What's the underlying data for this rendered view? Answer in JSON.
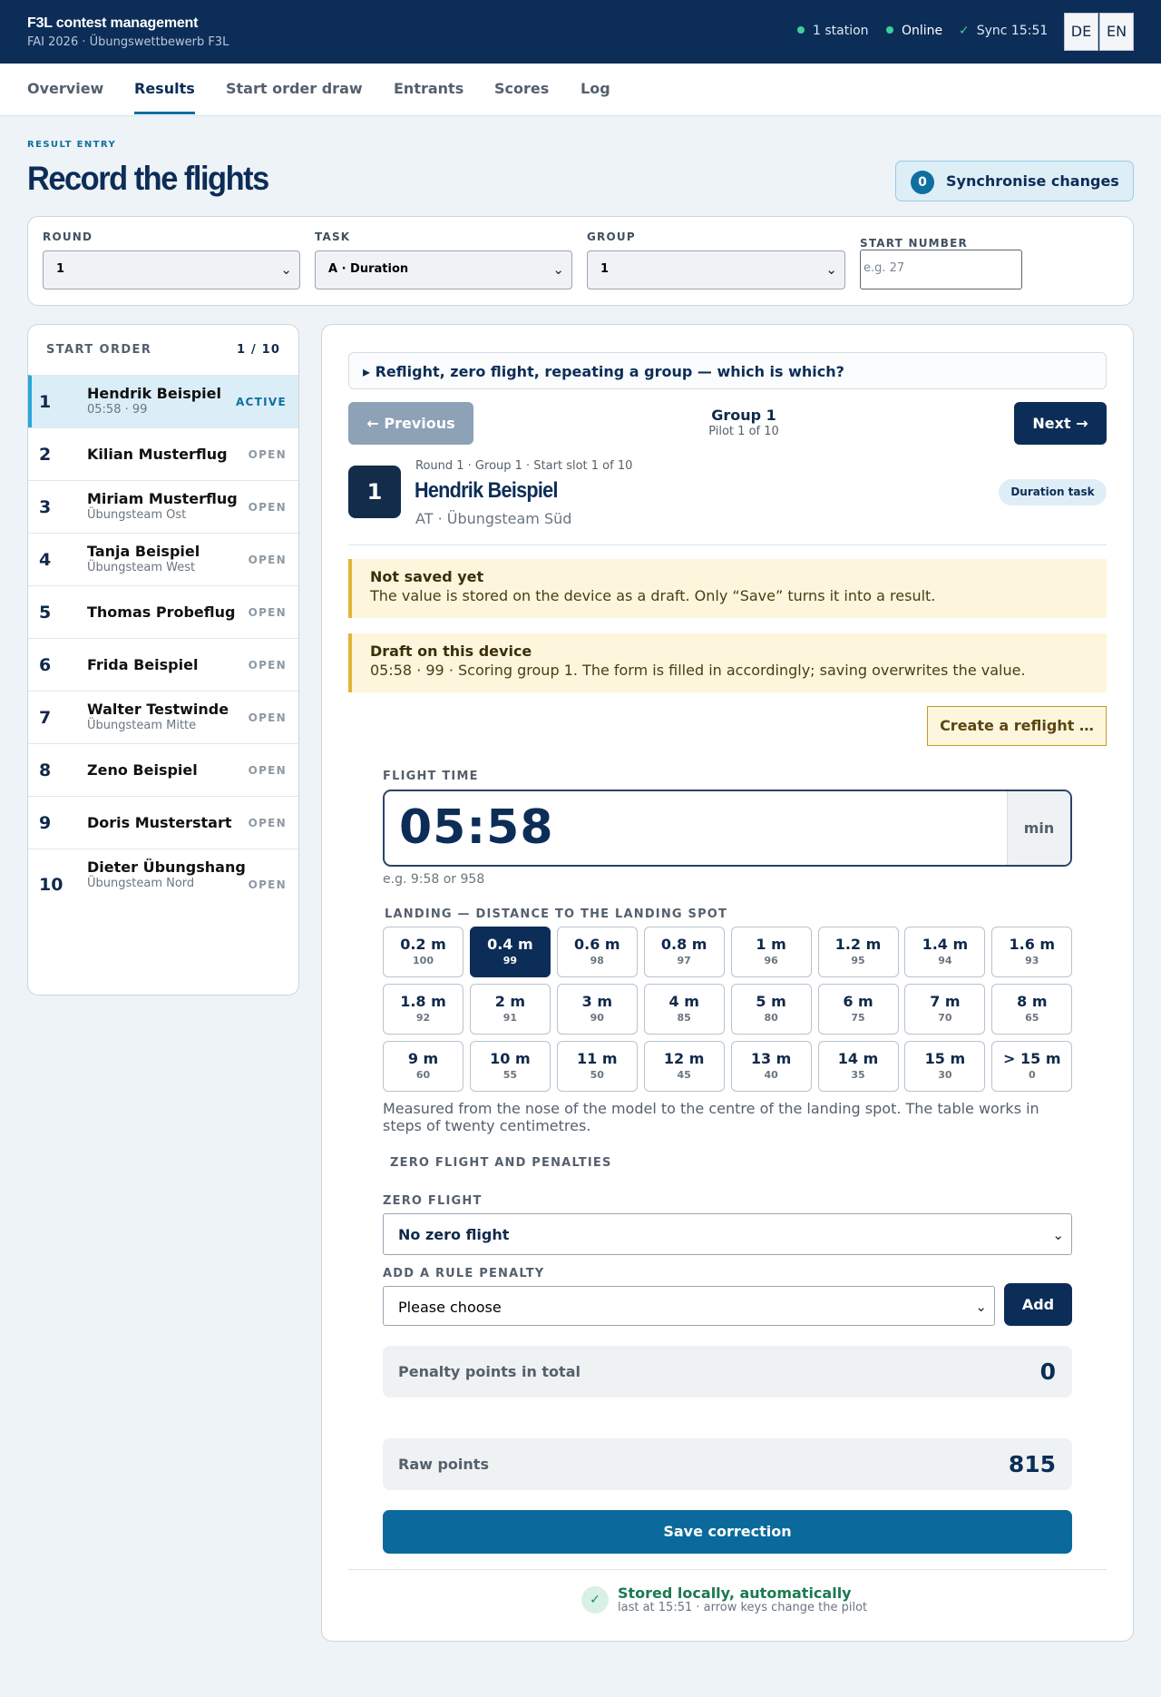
{
  "header": {
    "title": "F3L contest management",
    "subtitle": "FAI 2026 · Übungswettbewerb F3L",
    "stations": "1 station",
    "online": "Online",
    "sync": "Sync 15:51",
    "lang_de": "DE",
    "lang_en": "EN",
    "status_dot_color": "#3ecf9a"
  },
  "nav": {
    "tabs": [
      "Overview",
      "Results",
      "Start order draw",
      "Entrants",
      "Scores",
      "Log"
    ],
    "active": "Results"
  },
  "page": {
    "eyebrow": "RESULT ENTRY",
    "title": "Record the flights",
    "sync_count": "0",
    "sync_label": "Synchronise changes"
  },
  "filters": {
    "round_label": "ROUND",
    "round_value": "1",
    "task_label": "TASK",
    "task_value": "A · Duration",
    "group_label": "GROUP",
    "group_value": "1",
    "start_label": "START NUMBER",
    "start_placeholder": "e.g. 27"
  },
  "start_order": {
    "heading": "START ORDER",
    "count": "1 / 10",
    "rows": [
      {
        "num": "1",
        "name": "Hendrik Beispiel",
        "sub": "05:58 · 99",
        "status": "ACTIVE"
      },
      {
        "num": "2",
        "name": "Kilian Musterflug",
        "sub": "",
        "status": "OPEN"
      },
      {
        "num": "3",
        "name": "Miriam Musterflug",
        "sub": "Übungsteam Ost",
        "status": "OPEN"
      },
      {
        "num": "4",
        "name": "Tanja Beispiel",
        "sub": "Übungsteam West",
        "status": "OPEN"
      },
      {
        "num": "5",
        "name": "Thomas Probeflug",
        "sub": "",
        "status": "OPEN"
      },
      {
        "num": "6",
        "name": "Frida Beispiel",
        "sub": "",
        "status": "OPEN"
      },
      {
        "num": "7",
        "name": "Walter Testwinde",
        "sub": "Übungsteam Mitte",
        "status": "OPEN"
      },
      {
        "num": "8",
        "name": "Zeno Beispiel",
        "sub": "",
        "status": "OPEN"
      },
      {
        "num": "9",
        "name": "Doris Musterstart",
        "sub": "",
        "status": "OPEN"
      },
      {
        "num": "10",
        "name": "Dieter Übungshang",
        "sub": "Übungsteam Nord",
        "status": "OPEN"
      }
    ]
  },
  "entry": {
    "disclosure": "▸ Reflight, zero flight, repeating a group — which is which?",
    "prev": "← Previous",
    "next": "Next →",
    "group_title": "Group 1",
    "group_sub": "Pilot 1 of 10",
    "pilot_number": "1",
    "pilot_meta": "Round 1 · Group 1 · Start slot 1 of 10",
    "pilot_name": "Hendrik Beispiel",
    "pilot_team": "AT · Übungsteam Süd",
    "task_pill": "Duration task",
    "notice1_title": "Not saved yet",
    "notice1_text": "The value is stored on the device as a draft. Only “Save” turns it into a result.",
    "notice2_title": "Draft on this device",
    "notice2_text": "05:58 · 99 · Scoring group 1. The form is filled in accordingly; saving overwrites the value.",
    "reflight": "Create a reflight …",
    "flight_time_label": "FLIGHT TIME",
    "flight_time": "05:58",
    "flight_time_unit": "min",
    "flight_time_hint": "e.g. 9:58 or 958",
    "landing_label": "LANDING — DISTANCE TO THE LANDING SPOT",
    "landing_selected": "0.4 m",
    "landing": [
      {
        "d": "0.2 m",
        "p": "100"
      },
      {
        "d": "0.4 m",
        "p": "99"
      },
      {
        "d": "0.6 m",
        "p": "98"
      },
      {
        "d": "0.8 m",
        "p": "97"
      },
      {
        "d": "1 m",
        "p": "96"
      },
      {
        "d": "1.2 m",
        "p": "95"
      },
      {
        "d": "1.4 m",
        "p": "94"
      },
      {
        "d": "1.6 m",
        "p": "93"
      },
      {
        "d": "1.8 m",
        "p": "92"
      },
      {
        "d": "2 m",
        "p": "91"
      },
      {
        "d": "3 m",
        "p": "90"
      },
      {
        "d": "4 m",
        "p": "85"
      },
      {
        "d": "5 m",
        "p": "80"
      },
      {
        "d": "6 m",
        "p": "75"
      },
      {
        "d": "7 m",
        "p": "70"
      },
      {
        "d": "8 m",
        "p": "65"
      },
      {
        "d": "9 m",
        "p": "60"
      },
      {
        "d": "10 m",
        "p": "55"
      },
      {
        "d": "11 m",
        "p": "50"
      },
      {
        "d": "12 m",
        "p": "45"
      },
      {
        "d": "13 m",
        "p": "40"
      },
      {
        "d": "14 m",
        "p": "35"
      },
      {
        "d": "15 m",
        "p": "30"
      },
      {
        "d": "> 15 m",
        "p": "0"
      }
    ],
    "landing_desc": "Measured from the nose of the model to the centre of the landing spot. The table works in steps of twenty centimetres.",
    "zero_section": "ZERO FLIGHT AND PENALTIES",
    "zero_label": "ZERO FLIGHT",
    "zero_value": "No zero flight",
    "penalty_label": "ADD A RULE PENALTY",
    "penalty_value": "Please choose",
    "add": "Add",
    "penalty_total_label": "Penalty points in total",
    "penalty_total": "0",
    "raw_label": "Raw points",
    "raw_points": "815",
    "save": "Save correction",
    "stored_title": "Stored locally, automatically",
    "stored_sub": "last at 15:51 · arrow keys change the pilot"
  }
}
